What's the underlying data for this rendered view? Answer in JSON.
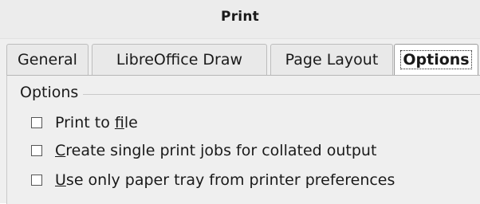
{
  "window": {
    "title": "Print"
  },
  "tabs": [
    {
      "label": "General",
      "active": false
    },
    {
      "label": "LibreOffice Draw",
      "active": false
    },
    {
      "label": "Page Layout",
      "active": false
    },
    {
      "label": "Options",
      "active": true
    }
  ],
  "options_group": {
    "heading": "Options",
    "items": [
      {
        "label_before": "Print to ",
        "mnemonic": "f",
        "label_after": "ile",
        "checked": false
      },
      {
        "label_before": "",
        "mnemonic": "C",
        "label_after": "reate single print jobs for collated output",
        "checked": false
      },
      {
        "label_before": "",
        "mnemonic": "U",
        "label_after": "se only paper tray from printer preferences",
        "checked": false
      }
    ]
  }
}
